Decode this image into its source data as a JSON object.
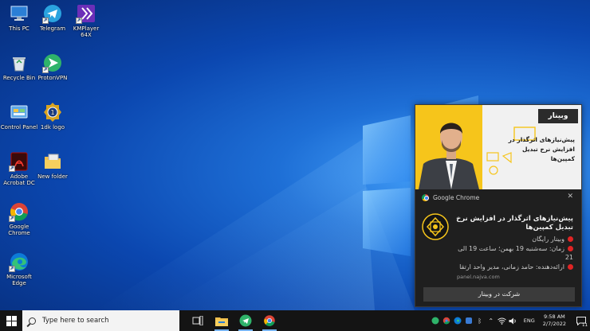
{
  "desktop": {
    "icons": [
      {
        "label": "This PC",
        "icon": "this-pc-icon"
      },
      {
        "label": "Telegram",
        "icon": "telegram-icon"
      },
      {
        "label": "KMPlayer 64X",
        "icon": "kmplayer-icon"
      },
      {
        "label": "Recycle Bin",
        "icon": "recycle-bin-icon"
      },
      {
        "label": "ProtonVPN",
        "icon": "protonvpn-icon"
      },
      {
        "label": "Control Panel",
        "icon": "control-panel-icon"
      },
      {
        "label": "1dk logo",
        "icon": "badge-logo-icon"
      },
      {
        "label": "Adobe Acrobat DC",
        "icon": "acrobat-icon"
      },
      {
        "label": "New folder",
        "icon": "folder-icon"
      },
      {
        "label": "Google Chrome",
        "icon": "chrome-icon"
      },
      {
        "label": "Microsoft Edge",
        "icon": "edge-icon"
      }
    ]
  },
  "notification": {
    "hero": {
      "badge": "وبینار",
      "headline": "پیش‌نیازهای اثرگذار در افزایش نرخ تبدیل کمپین‌ها"
    },
    "app_name": "Google Chrome",
    "title": "پیش‌نیازهای اثرگذار در افزایش نرخ تبدیل کمپین‌ها",
    "line1": "وبینار رایگان",
    "line2": "زمان: سه‌شنبه 19 بهمن؛ ساعت 19 الی 21",
    "line3": "ارائه‌دهنده: حامد زمانی، مدیر واحد ارتقا",
    "source": "panel.najva.com",
    "action_label": "شرکت در وبینار",
    "dot_color": "#e02424"
  },
  "taskbar": {
    "search_placeholder": "Type here to search",
    "apps": [
      {
        "icon": "task-view-icon"
      },
      {
        "icon": "file-explorer-icon"
      },
      {
        "icon": "telegram-icon"
      },
      {
        "icon": "chrome-icon"
      }
    ],
    "language": "ENG",
    "time": "9:58 AM",
    "date": "2/7/2022",
    "notification_count": "11"
  }
}
